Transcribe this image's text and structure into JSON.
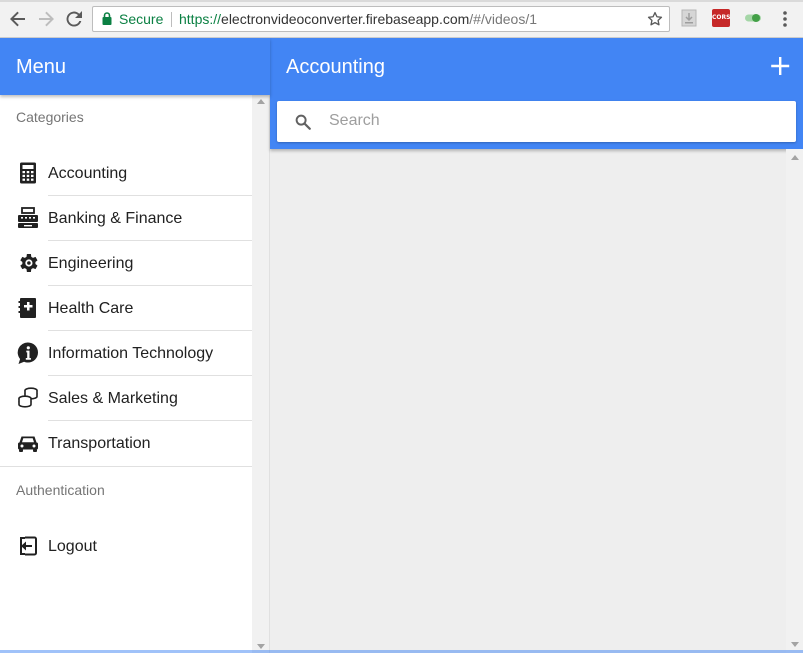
{
  "browser": {
    "secure_label": "Secure",
    "url_protocol": "https://",
    "url_host": "electronvideoconverter.firebaseapp.com",
    "url_path": "/#/videos/1",
    "extension_cors_label": "CORS"
  },
  "sidebar": {
    "title": "Menu",
    "categories_header": "Categories",
    "items": [
      {
        "label": "Accounting",
        "icon": "calculator-icon"
      },
      {
        "label": "Banking & Finance",
        "icon": "cash-register-icon"
      },
      {
        "label": "Engineering",
        "icon": "gear-icon"
      },
      {
        "label": "Health Care",
        "icon": "medical-book-icon"
      },
      {
        "label": "Information Technology",
        "icon": "info-bubble-icon"
      },
      {
        "label": "Sales & Marketing",
        "icon": "coins-icon"
      },
      {
        "label": "Transportation",
        "icon": "car-icon"
      }
    ],
    "auth_header": "Authentication",
    "logout_label": "Logout"
  },
  "main": {
    "title": "Accounting",
    "search_placeholder": "Search",
    "search_value": ""
  },
  "colors": {
    "primary": "#4285f4",
    "secure_green": "#0b8043",
    "content_bg": "#eeeeee"
  }
}
